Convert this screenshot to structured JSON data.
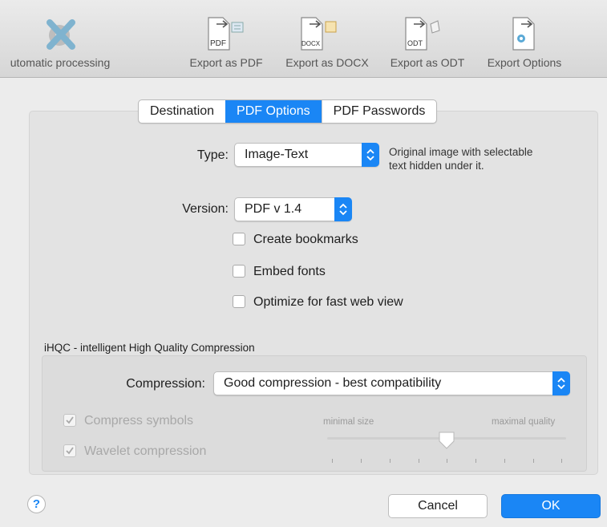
{
  "toolbar": {
    "items": [
      {
        "label": "utomatic processing",
        "icon": "automatic-processing-icon"
      },
      {
        "label": "Export as PDF",
        "icon": "pdf-export-icon",
        "badge": "PDF"
      },
      {
        "label": "Export as DOCX",
        "icon": "docx-export-icon",
        "badge": "DOCX"
      },
      {
        "label": "Export as ODT",
        "icon": "odt-export-icon",
        "badge": "ODT"
      },
      {
        "label": "Export Options",
        "icon": "export-options-icon"
      }
    ]
  },
  "tabs": [
    {
      "label": "Destination",
      "selected": false
    },
    {
      "label": "PDF Options",
      "selected": true
    },
    {
      "label": "PDF Passwords",
      "selected": false
    }
  ],
  "type": {
    "label": "Type:",
    "value": "Image-Text",
    "description_line1": "Original image with selectable",
    "description_line2": "text hidden under it."
  },
  "version": {
    "label": "Version:",
    "value": "PDF v 1.4"
  },
  "options": {
    "create_bookmarks": {
      "label": "Create bookmarks",
      "checked": false
    },
    "embed_fonts": {
      "label": "Embed fonts",
      "checked": false
    },
    "optimize_web": {
      "label": "Optimize for fast web view",
      "checked": false
    }
  },
  "ihqc": {
    "title": "iHQC - intelligent High Quality Compression",
    "compression_label": "Compression:",
    "compression_value": "Good compression - best compatibility",
    "compress_symbols": {
      "label": "Compress symbols",
      "checked": true,
      "enabled": false
    },
    "wavelet": {
      "label": "Wavelet compression",
      "checked": true,
      "enabled": false
    },
    "slider": {
      "min_label": "minimal size",
      "max_label": "maximal quality",
      "value_fraction": 0.5
    }
  },
  "footer": {
    "help": "?",
    "cancel": "Cancel",
    "ok": "OK"
  },
  "colors": {
    "accent": "#1a86f5",
    "window_bg": "#ececec"
  }
}
